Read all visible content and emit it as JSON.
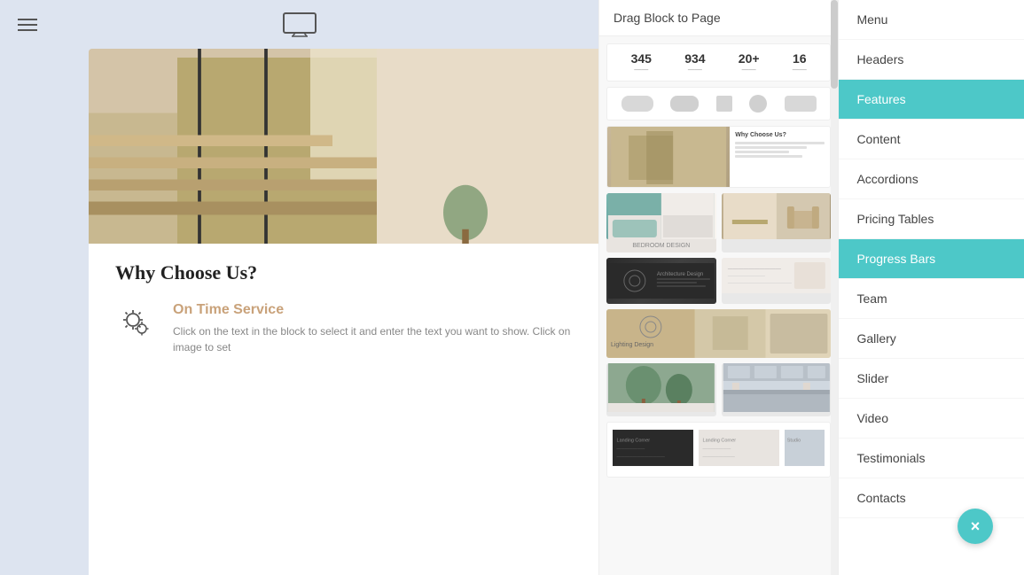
{
  "topbar": {
    "monitor_icon_label": "monitor"
  },
  "header": {
    "title": "Drag Block to Page"
  },
  "preview": {
    "page_title": "Why Choose Us?",
    "feature_title": "On Time Service",
    "feature_description": "Click on the text in the block to select it and enter the text you want to show. Click on image to set",
    "stats": [
      {
        "number": "345",
        "label": ""
      },
      {
        "number": "934",
        "label": ""
      },
      {
        "number": "20+",
        "label": ""
      },
      {
        "number": "16",
        "label": ""
      }
    ]
  },
  "nav_items": [
    {
      "id": "menu",
      "label": "Menu",
      "active": false
    },
    {
      "id": "headers",
      "label": "Headers",
      "active": false
    },
    {
      "id": "features",
      "label": "Features",
      "active": true
    },
    {
      "id": "content",
      "label": "Content",
      "active": false
    },
    {
      "id": "accordions",
      "label": "Accordions",
      "active": false
    },
    {
      "id": "pricing-tables",
      "label": "Pricing Tables",
      "active": false
    },
    {
      "id": "progress-bars",
      "label": "Progress Bars",
      "active": true
    },
    {
      "id": "team",
      "label": "Team",
      "active": false
    },
    {
      "id": "gallery",
      "label": "Gallery",
      "active": false
    },
    {
      "id": "slider",
      "label": "Slider",
      "active": false
    },
    {
      "id": "video",
      "label": "Video",
      "active": false
    },
    {
      "id": "testimonials",
      "label": "Testimonials",
      "active": false
    },
    {
      "id": "contacts",
      "label": "Contacts",
      "active": false
    }
  ],
  "close_button_label": "×",
  "colors": {
    "active_bg": "#4dc8c8",
    "active_text": "#ffffff",
    "close_btn_bg": "#4dc8c8"
  }
}
